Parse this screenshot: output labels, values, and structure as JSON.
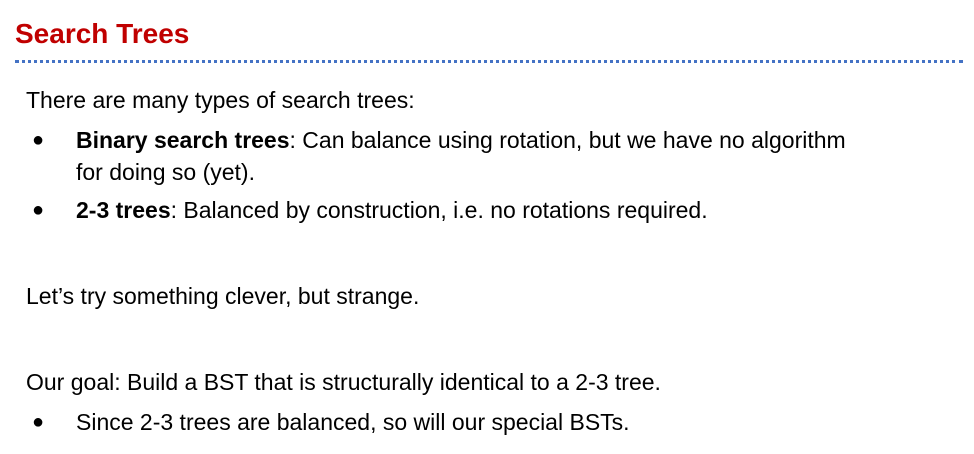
{
  "title": "Search Trees",
  "intro": "There are many types of search trees:",
  "bullets": [
    {
      "term": "Binary search trees",
      "rest_line1": ": Can balance using rotation, but we have no algorithm",
      "rest_line2": "for doing so (yet)."
    },
    {
      "term": "2-3 trees",
      "rest_line1": ": Balanced by construction, i.e. no rotations required."
    }
  ],
  "clever": "Let’s try something clever, but strange.",
  "goal": "Our goal: Build a BST that is structurally identical to a 2-3 tree.",
  "goal_bullets": [
    "Since 2-3 trees are balanced, so will our special BSTs."
  ],
  "bullet_symbol": "●",
  "colors": {
    "title": "#c00000",
    "rule": "#4472c4"
  }
}
